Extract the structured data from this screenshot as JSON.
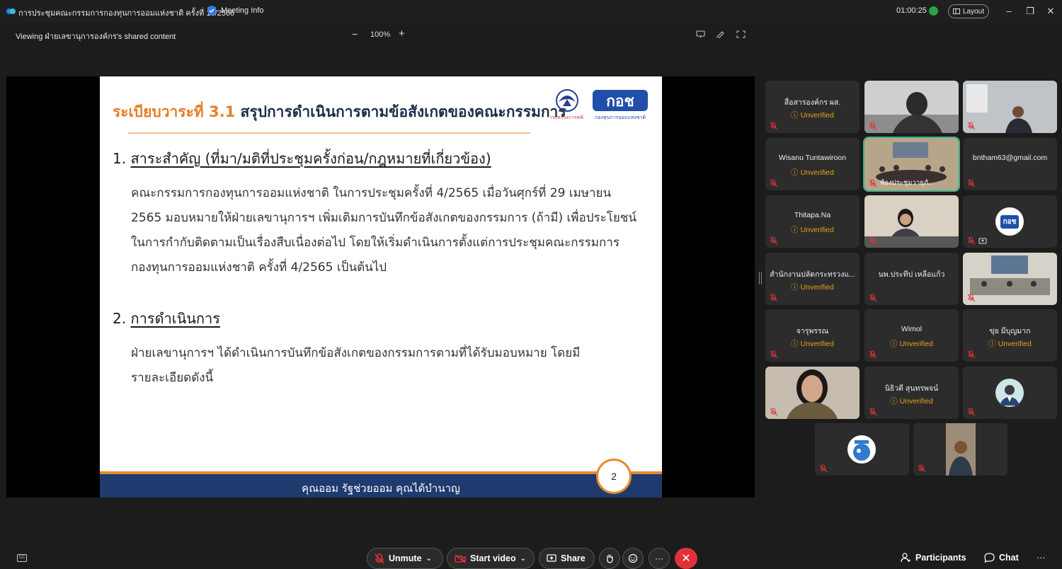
{
  "window": {
    "title": "การประชุมคณะกรรมการกองทุนการออมแห่งชาติ ครั้งที่ 10/2566",
    "meeting_info": "Meeting Info",
    "timer": "01:00:25",
    "layout": "Layout",
    "minimize": "–",
    "restore": "❐",
    "close": "✕"
  },
  "share_toolbar": {
    "viewing": "Viewing ฝ่ายเลขานุการองค์กร's shared content",
    "zoom_out": "−",
    "zoom_level": "100%",
    "zoom_in": "+"
  },
  "slide": {
    "agenda_label": "ระเบียบวาระที่ 3.1",
    "agenda_topic": " สรุปการดำเนินการตามข้อสังเกตของคณะกรรมการ",
    "section1_num": "1. ",
    "section1_title": "สาระสำคัญ (ที่มา/มติที่ประชุมครั้งก่อน/กฎหมายที่เกี่ยวข้อง)",
    "section1_lines": [
      "คณะกรรมการกองทุนการออมแห่งชาติ ในการประชุมครั้งที่ 4/2565 เมื่อวันศุกร์ที่ 29 เมษายน",
      "2565 มอบหมายให้ฝ่ายเลขานุการฯ เพิ่มเติมการบันทึกข้อสังเกตของกรรมการ (ถ้ามี) เพื่อประโยชน์",
      "ในการกำกับติดตามเป็นเรื่องสืบเนื่องต่อไป โดยให้เริ่มดำเนินการตั้งแต่การประชุมคณะกรรมการ",
      "กองทุนการออมแห่งชาติ ครั้งที่ 4/2565 เป็นต้นไป"
    ],
    "section2_num": "2. ",
    "section2_title": "การดำเนินการ",
    "section2_lines": [
      "ฝ่ายเลขานุการฯ ได้ดำเนินการบันทึกข้อสังเกตของกรรมการตามที่ได้รับมอบหมาย โดยมี",
      "รายละเอียดดังนี้"
    ],
    "slogan": "คุณออม รัฐช่วยออม คุณได้บำนาญ",
    "page_number": "2",
    "ministry_logo_text": "กระทรวงการคลัง",
    "fund_logo_text": "กอช",
    "fund_logo_sub": "กองทุนการออมแห่งชาติ"
  },
  "participants": [
    {
      "name": "สื่อสารองค์กร ผส.",
      "status": "Unverified",
      "video": false
    },
    {
      "name": "",
      "status": "",
      "video": true,
      "scene": "person-dark"
    },
    {
      "name": "",
      "status": "",
      "video": true,
      "scene": "office-man"
    },
    {
      "name": "Wisanu Tuntawiroon",
      "status": "Unverified",
      "video": false
    },
    {
      "name": "",
      "status": "",
      "video": true,
      "scene": "meeting-room",
      "label": "ห้องประชุมวายุภั..."
    },
    {
      "name": "bntham63@gmail.com",
      "status": "",
      "video": false
    },
    {
      "name": "Thitapa.Na",
      "status": "Unverified",
      "video": false
    },
    {
      "name": "",
      "status": "",
      "video": true,
      "scene": "woman-desk"
    },
    {
      "name": "",
      "status": "",
      "video": false,
      "avatar": "กอช"
    },
    {
      "name": "สำนักงานปลัดกระทรวงแ...",
      "status": "Unverified",
      "video": false
    },
    {
      "name": "นพ.ประทีป เหลือแก้ว",
      "status": "",
      "video": false
    },
    {
      "name": "",
      "status": "",
      "video": true,
      "scene": "conference"
    },
    {
      "name": "จารุพรรณ",
      "status": "Unverified",
      "video": false
    },
    {
      "name": "Wimol",
      "status": "Unverified",
      "video": false
    },
    {
      "name": "ขุ่ย มีบุญมาก",
      "status": "Unverified",
      "video": false
    },
    {
      "name": "",
      "status": "",
      "video": true,
      "scene": "woman-close"
    },
    {
      "name": "นิธิวดี สุนทรพจน์",
      "status": "Unverified",
      "video": false
    },
    {
      "name": "",
      "status": "",
      "video": false,
      "avatar": "person"
    },
    {
      "name": "",
      "status": "",
      "video": false,
      "avatar": "logo-blue"
    },
    {
      "name": "",
      "status": "",
      "video": true,
      "scene": "man-outdoor"
    }
  ],
  "controls": {
    "unmute": "Unmute",
    "start_video": "Start video",
    "share": "Share",
    "more": "···",
    "participants": "Participants",
    "chat": "Chat",
    "overflow": "···",
    "cc": "CC"
  },
  "colors": {
    "leave": "#e0323a",
    "unverified": "#e8a11c",
    "slide_accent": "#e87d26",
    "slide_bar": "#1f3a6e"
  }
}
